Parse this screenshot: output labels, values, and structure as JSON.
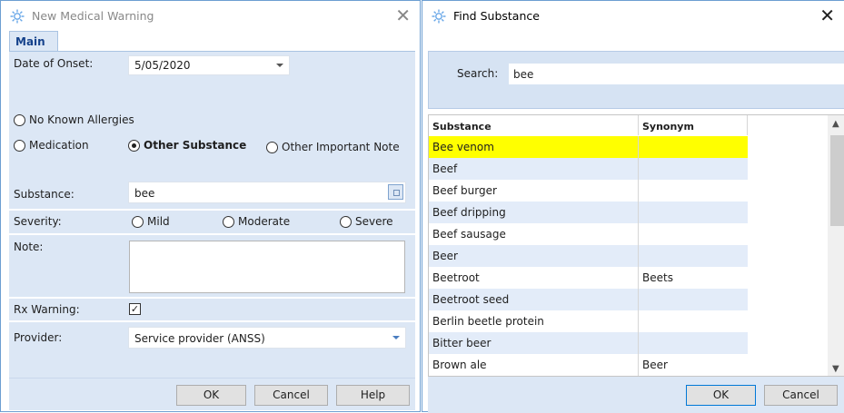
{
  "colors": {
    "accent": "#15428b",
    "panel_bg": "#dce7f5",
    "row_alt": "#e3ecf9",
    "selected_row": "#ffff00",
    "icon": "#6aa8e8"
  },
  "left_dialog": {
    "title": "New Medical Warning",
    "icon": "gear-icon",
    "close_glyph": "✕",
    "tab_main": "Main",
    "date_of_onset_label": "Date of Onset:",
    "date_of_onset_value": "5/05/2020",
    "radio_no_known_allergies": "No Known Allergies",
    "radio_medication": "Medication",
    "radio_other_substance": "Other Substance",
    "radio_other_important_note": "Other Important Note",
    "selected_radio": "Other Substance",
    "substance_label": "Substance:",
    "substance_value": "bee",
    "severity_label": "Severity:",
    "severity_mild": "Mild",
    "severity_moderate": "Moderate",
    "severity_severe": "Severe",
    "note_label": "Note:",
    "note_value": "",
    "rx_warning_label": "Rx Warning:",
    "rx_warning_checked": true,
    "provider_label": "Provider:",
    "provider_value": "Service provider (ANSS)",
    "ok_label": "OK",
    "cancel_label": "Cancel",
    "help_label": "Help"
  },
  "right_dialog": {
    "title": "Find Substance",
    "icon": "gear-icon",
    "close_glyph": "✕",
    "search_label": "Search:",
    "search_value": "bee",
    "columns": [
      "Substance",
      "Synonym"
    ],
    "rows": [
      {
        "substance": "Bee venom",
        "synonym": "",
        "selected": true
      },
      {
        "substance": "Beef",
        "synonym": ""
      },
      {
        "substance": "Beef burger",
        "synonym": ""
      },
      {
        "substance": "Beef dripping",
        "synonym": ""
      },
      {
        "substance": "Beef sausage",
        "synonym": ""
      },
      {
        "substance": "Beer",
        "synonym": ""
      },
      {
        "substance": "Beetroot",
        "synonym": "Beets"
      },
      {
        "substance": "Beetroot seed",
        "synonym": ""
      },
      {
        "substance": "Berlin beetle protein",
        "synonym": ""
      },
      {
        "substance": "Bitter beer",
        "synonym": ""
      },
      {
        "substance": "Brown ale",
        "synonym": "Beer"
      }
    ],
    "ok_label": "OK",
    "cancel_label": "Cancel"
  }
}
